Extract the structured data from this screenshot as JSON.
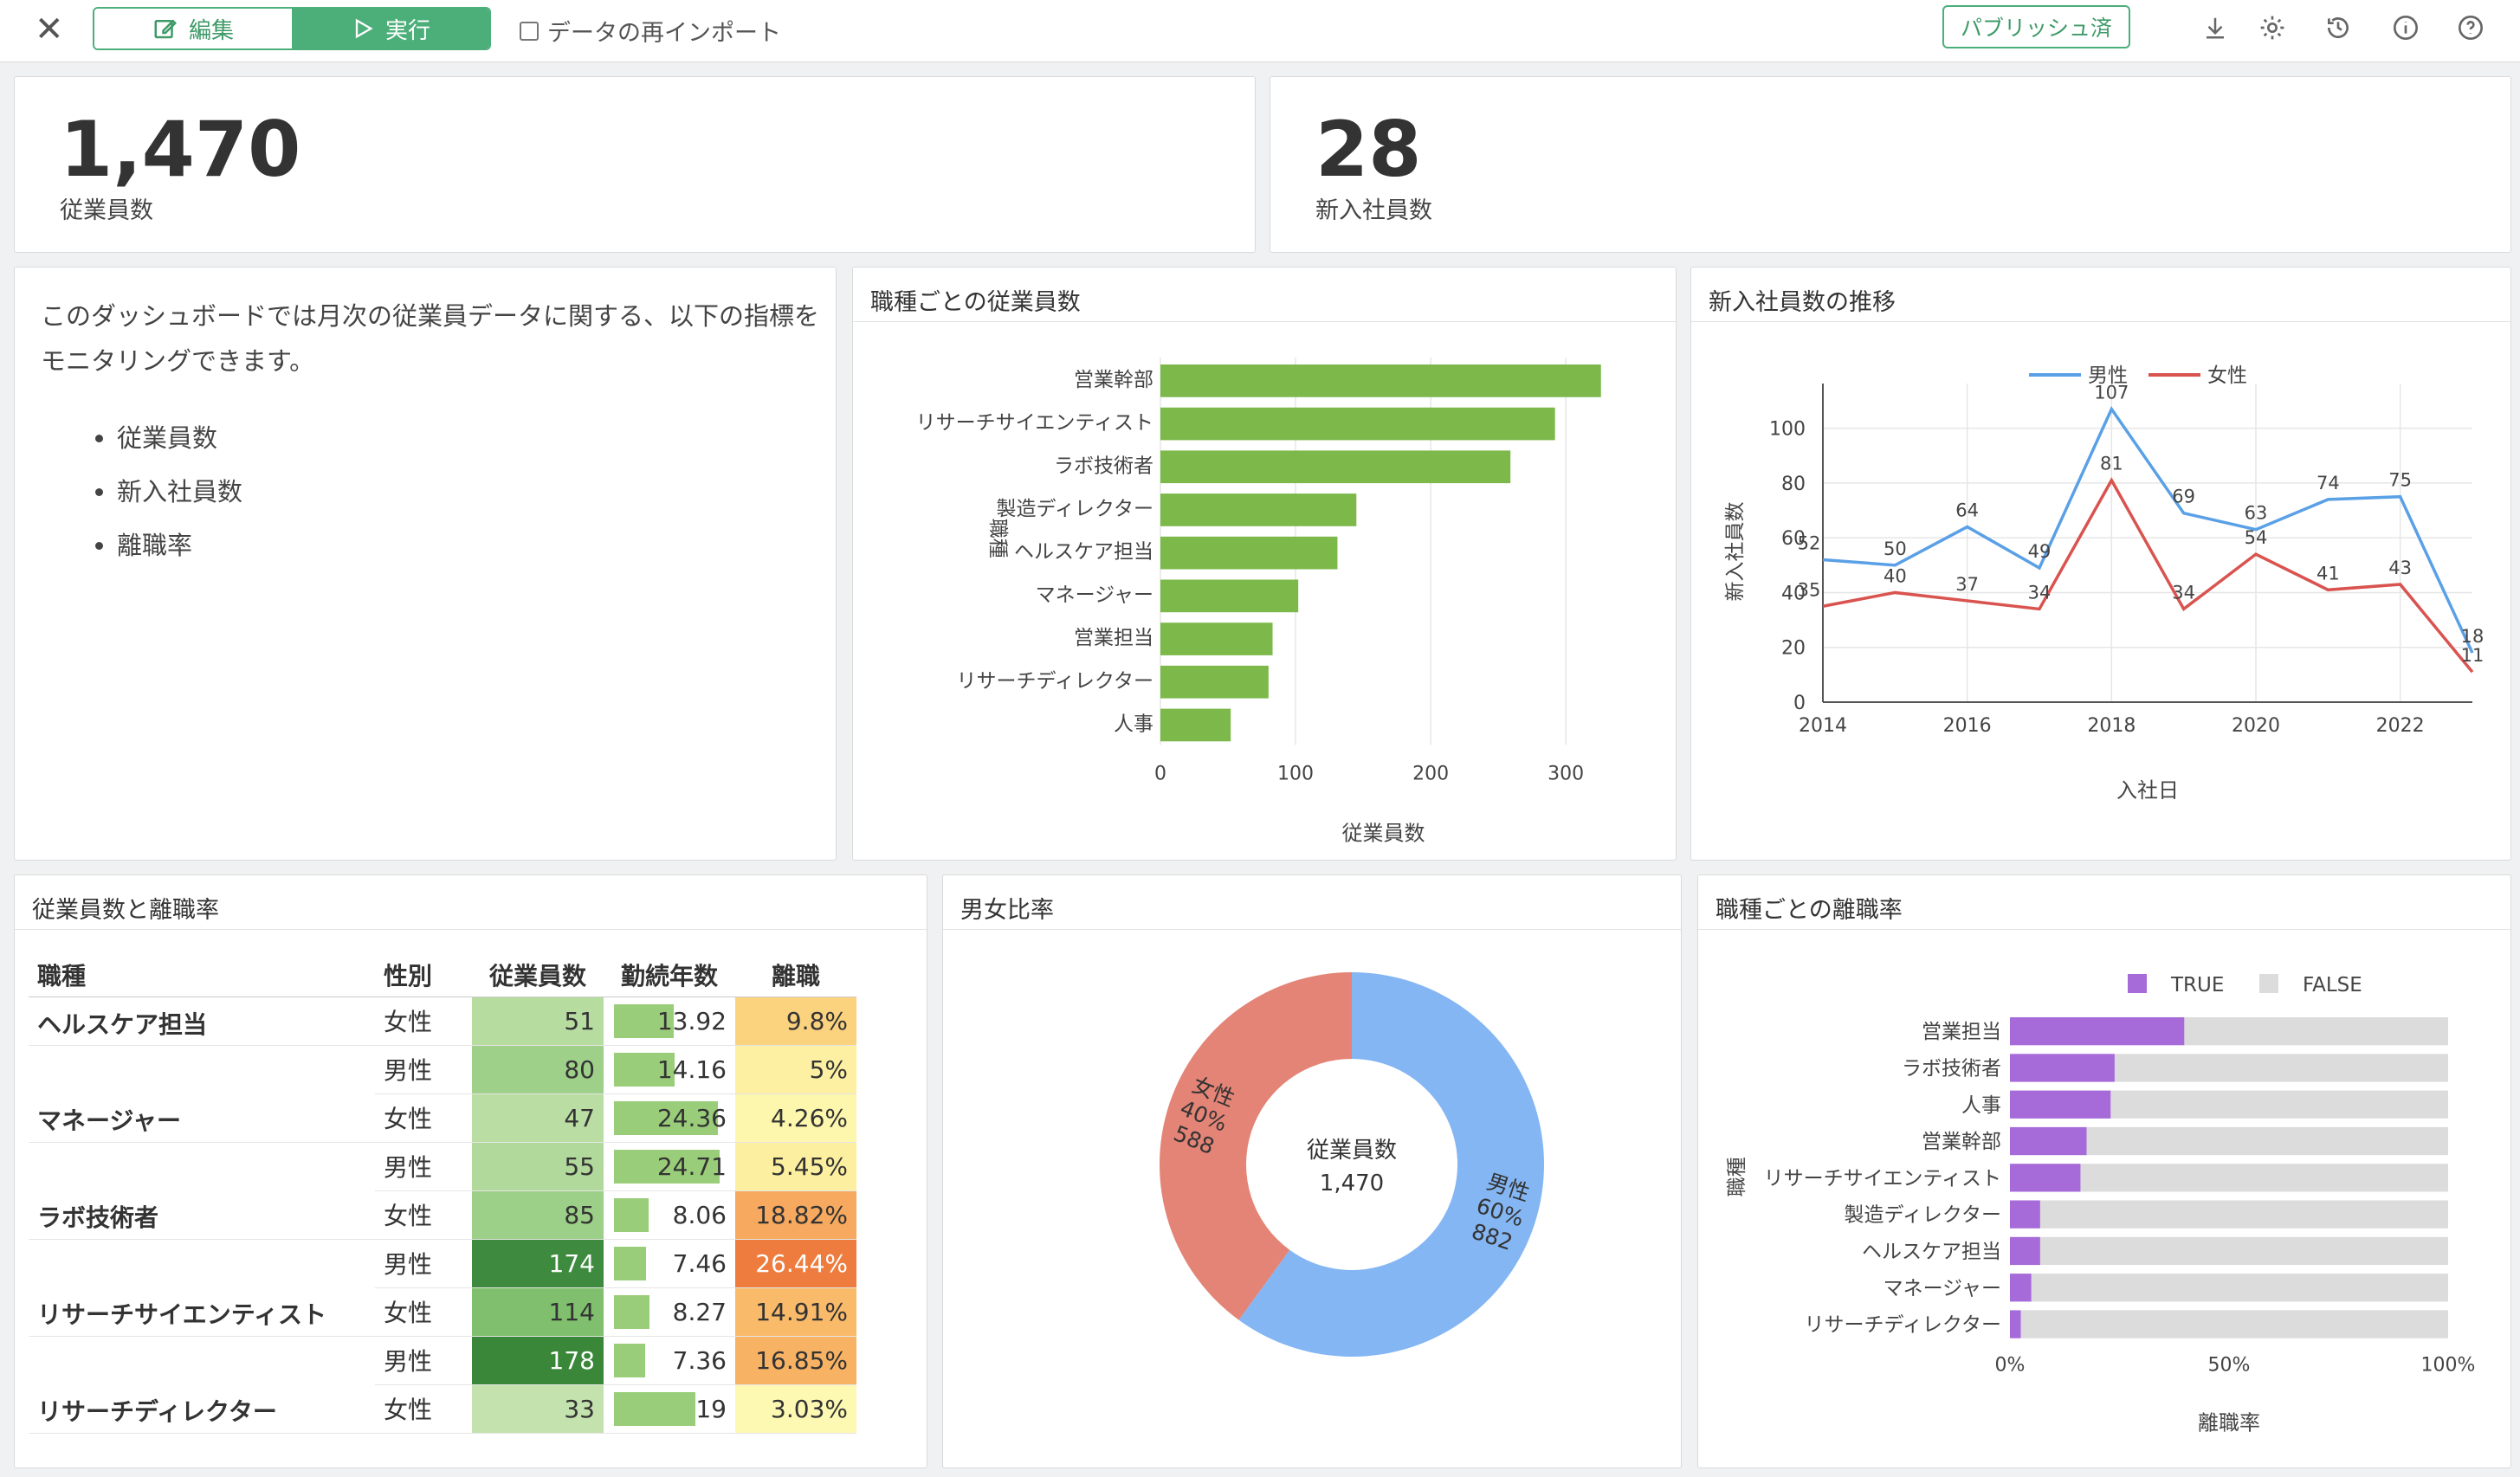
{
  "toolbar": {
    "edit_label": "編集",
    "run_label": "実行",
    "reimport_label": "データの再インポート",
    "publish_label": "パブリッシュ済"
  },
  "kpi": [
    {
      "value": "1,470",
      "label": "従業員数"
    },
    {
      "value": "28",
      "label": "新入社員数"
    }
  ],
  "description": {
    "text": "このダッシュボードでは月次の従業員データに関する、以下の指標をモニタリングできます。",
    "items": [
      "従業員数",
      "新入社員数",
      "離職率"
    ]
  },
  "panels": {
    "jobs_title": "職種ごとの従業員数",
    "hires_title": "新入社員数の推移",
    "table_title": "従業員数と離職率",
    "gender_title": "男女比率",
    "attrition_title": "職種ごとの離職率"
  },
  "table": {
    "headers": [
      "職種",
      "性別",
      "従業員数",
      "勤続年数",
      "離職"
    ],
    "rows": [
      {
        "job": "ヘルスケア担当",
        "gender": "女性",
        "count": "51",
        "tenure": "13.92",
        "rate": "9.8%"
      },
      {
        "job": "",
        "gender": "男性",
        "count": "80",
        "tenure": "14.16",
        "rate": "5%"
      },
      {
        "job": "マネージャー",
        "gender": "女性",
        "count": "47",
        "tenure": "24.36",
        "rate": "4.26%"
      },
      {
        "job": "",
        "gender": "男性",
        "count": "55",
        "tenure": "24.71",
        "rate": "5.45%"
      },
      {
        "job": "ラボ技術者",
        "gender": "女性",
        "count": "85",
        "tenure": "8.06",
        "rate": "18.82%"
      },
      {
        "job": "",
        "gender": "男性",
        "count": "174",
        "tenure": "7.46",
        "rate": "26.44%"
      },
      {
        "job": "リサーチサイエンティスト",
        "gender": "女性",
        "count": "114",
        "tenure": "8.27",
        "rate": "14.91%"
      },
      {
        "job": "",
        "gender": "男性",
        "count": "178",
        "tenure": "7.36",
        "rate": "16.85%"
      },
      {
        "job": "リサーチディレクター",
        "gender": "女性",
        "count": "33",
        "tenure": "19",
        "rate": "3.03%"
      }
    ],
    "colors": {
      "count": [
        "#b7dca0",
        "#9fd08a",
        "#b9dda3",
        "#b1d99b",
        "#9ccf87",
        "#3e8a3e",
        "#7fbf6d",
        "#3a873a",
        "#c3e2ad"
      ],
      "rate": [
        "#fbd27e",
        "#fdf0a2",
        "#fdf6ad",
        "#fcef9f",
        "#f6a95f",
        "#ed7c3e",
        "#f9ba69",
        "#f8b264",
        "#fdf8b2"
      ]
    }
  },
  "chart_data": [
    {
      "type": "bar",
      "orientation": "horizontal",
      "categories": [
        "営業幹部",
        "リサーチサイエンティスト",
        "ラボ技術者",
        "製造ディレクター",
        "ヘルスケア担当",
        "マネージャー",
        "営業担当",
        "リサーチディレクター",
        "人事"
      ],
      "values": [
        326,
        292,
        259,
        145,
        131,
        102,
        83,
        80,
        52
      ],
      "xlabel": "従業員数",
      "ylabel": "職種",
      "xlim": [
        0,
        330
      ],
      "xticks": [
        0,
        100,
        200,
        300
      ],
      "grid": true,
      "color": "#7cb84a"
    },
    {
      "type": "line",
      "x": [
        2014,
        2015,
        2016,
        2017,
        2018,
        2019,
        2020,
        2021,
        2022,
        2023
      ],
      "series": [
        {
          "name": "男性",
          "color": "#5aa0e6",
          "values": [
            52,
            50,
            64,
            49,
            107,
            69,
            63,
            74,
            75,
            18
          ]
        },
        {
          "name": "女性",
          "color": "#d9534f",
          "values": [
            35,
            40,
            37,
            34,
            81,
            34,
            54,
            41,
            43,
            11
          ]
        }
      ],
      "xlabel": "入社日",
      "ylabel": "新入社員数",
      "xticks": [
        2014,
        2016,
        2018,
        2020,
        2022
      ],
      "yticks": [
        0,
        20,
        40,
        60,
        80,
        100
      ],
      "ylim": [
        0,
        110
      ],
      "legend": "top"
    },
    {
      "type": "pie",
      "donut": true,
      "center_label": "従業員数",
      "center_value": "1,470",
      "slices": [
        {
          "name": "男性",
          "value": 882,
          "percent": "60%",
          "color": "#84b6f3"
        },
        {
          "name": "女性",
          "value": 588,
          "percent": "40%",
          "color": "#e38476"
        }
      ]
    },
    {
      "type": "bar",
      "stacked": true,
      "orientation": "horizontal",
      "categories": [
        "営業担当",
        "ラボ技術者",
        "人事",
        "営業幹部",
        "リサーチサイエンティスト",
        "製造ディレクター",
        "ヘルスケア担当",
        "マネージャー",
        "リサーチディレクター"
      ],
      "series": [
        {
          "name": "TRUE",
          "color": "#a66ad9",
          "values": [
            39.8,
            23.9,
            23.0,
            17.5,
            16.1,
            6.9,
            6.9,
            4.9,
            2.5
          ]
        },
        {
          "name": "FALSE",
          "color": "#dcdcdc",
          "values": [
            60.2,
            76.1,
            77.0,
            82.5,
            83.9,
            93.1,
            93.1,
            95.1,
            97.5
          ]
        }
      ],
      "xlabel": "離職率",
      "ylabel": "職種",
      "xticks": [
        "0%",
        "50%",
        "100%"
      ],
      "xlim": [
        0,
        100
      ],
      "legend": "top"
    }
  ]
}
